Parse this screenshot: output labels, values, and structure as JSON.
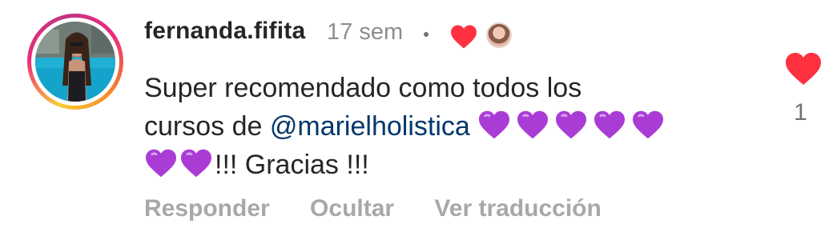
{
  "comment": {
    "username": "fernanda.fifita",
    "timestamp": "17 sem",
    "separator": "•",
    "author_liked_icon": "heart-icon",
    "text_line1": "Super recomendado como todos los",
    "text_line2_prefix": "cursos de ",
    "mention": "@marielholistica",
    "text_line3_suffix": "!!! Gracias !!!",
    "emoji": "purple-heart",
    "like_count": "1",
    "colors": {
      "heart_red": "#ff3040",
      "purple_heart": "#aa3cd6",
      "mention": "#00376b",
      "muted": "#a8a8a8"
    }
  },
  "actions": {
    "reply": "Responder",
    "hide": "Ocultar",
    "translate": "Ver traducción"
  }
}
